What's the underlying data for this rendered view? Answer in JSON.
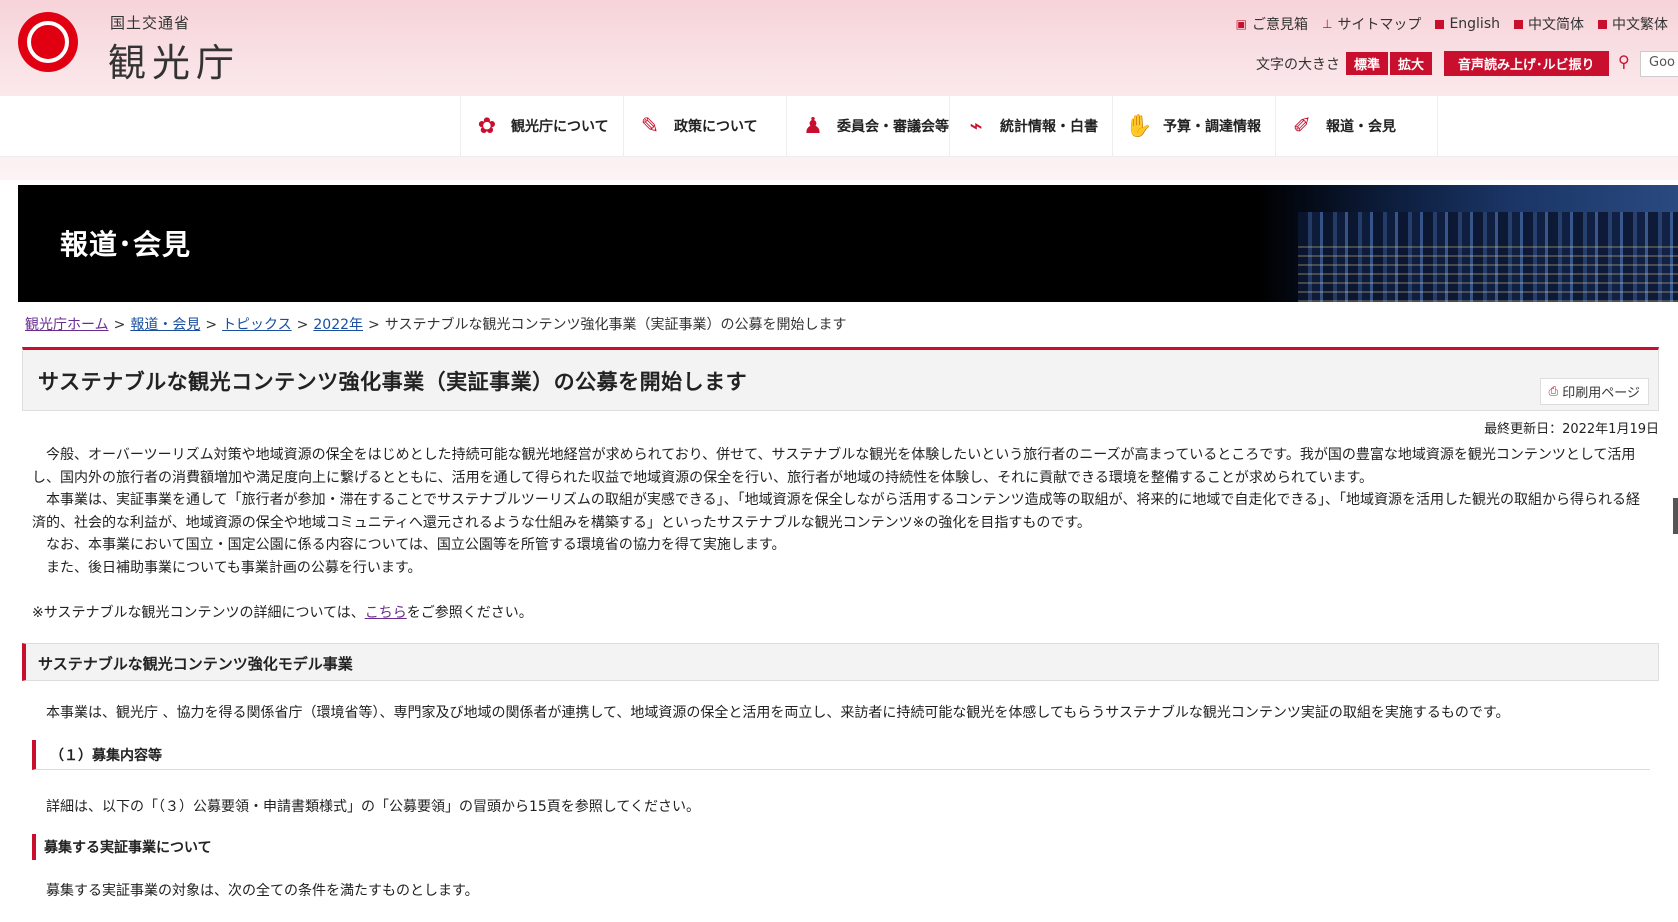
{
  "header": {
    "ministry": "国土交通省",
    "agency": "観光庁",
    "util_links": [
      {
        "label": "ご意見箱",
        "icon": "mailbox-icon"
      },
      {
        "label": "サイトマップ",
        "icon": "sitemap-icon"
      },
      {
        "label": "English",
        "icon": "square-bullet-icon"
      },
      {
        "label": "中文简体",
        "icon": "square-bullet-icon"
      },
      {
        "label": "中文繁体",
        "icon": "square-bullet-icon"
      }
    ],
    "font_size_label": "文字の大きさ",
    "font_standard": "標準",
    "font_large": "拡大",
    "voice_button": "音声読み上げ･ルビ振り",
    "search_placeholder": "Goo"
  },
  "nav": [
    {
      "label": "観光庁について",
      "icon": "flower-icon"
    },
    {
      "label": "政策について",
      "icon": "pencil-icon"
    },
    {
      "label": "委員会・審議会等",
      "icon": "people-icon"
    },
    {
      "label": "統計情報・白書",
      "icon": "chart-icon"
    },
    {
      "label": "予算・調達情報",
      "icon": "handshake-icon"
    },
    {
      "label": "報道・会見",
      "icon": "microphone-icon"
    }
  ],
  "banner": {
    "title": "報道･会見"
  },
  "breadcrumb": {
    "items": [
      "観光庁ホーム",
      "報道・会見",
      "トピックス",
      "2022年"
    ],
    "current": "サステナブルな観光コンテンツ強化事業（実証事業）の公募を開始します",
    "separator": ">"
  },
  "page": {
    "title": "サステナブルな観光コンテンツ強化事業（実証事業）の公募を開始します",
    "print_label": "印刷用ページ",
    "updated": "最終更新日：2022年1月19日",
    "paragraphs": [
      "今般、オーバーツーリズム対策や地域資源の保全をはじめとした持続可能な観光地経営が求められており、併せて、サステナブルな観光を体験したいという旅行者のニーズが高まっているところです。我が国の豊富な地域資源を観光コンテンツとして活用し、国内外の旅行者の消費額増加や満足度向上に繋げるとともに、活用を通して得られた収益で地域資源の保全を行い、旅行者が地域の持続性を体験し、それに貢献できる環境を整備することが求められています。",
      "本事業は、実証事業を通して「旅行者が参加・滞在することでサステナブルツーリズムの取組が実感できる」、「地域資源を保全しながら活用するコンテンツ造成等の取組が、将来的に地域で自走化できる」、「地域資源を活用した観光の取組から得られる経済的、社会的な利益が、地域資源の保全や地域コミュニティへ還元されるような仕組みを構築する」といったサステナブルな観光コンテンツ※の強化を目指すものです。",
      "なお、本事業において国立・国定公園に係る内容については、国立公園等を所管する環境省の協力を得て実施します。",
      "また、後日補助事業についても事業計画の公募を行います。"
    ],
    "note_prefix": "※サステナブルな観光コンテンツの詳細については、",
    "note_link": "こちら",
    "note_suffix": "をご参照ください。",
    "section_title": "サステナブルな観光コンテンツ強化モデル事業",
    "section_text": "本事業は、観光庁 、協力を得る関係省庁（環境省等）、専門家及び地域の関係者が連携して、地域資源の保全と活用を両立し、来訪者に持続可能な観光を体感してもらうサステナブルな観光コンテンツ実証の取組を実施するものです。",
    "sub_title": "（１）募集内容等",
    "sub_text": "詳細は、以下の「（３）公募要領・申請書類様式」の「公募要領」の冒頭から15頁を参照してください。",
    "sub2_title": "募集する実証事業について",
    "sub2_text": "募集する実証事業の対象は、次の全ての条件を満たすものとします。"
  },
  "colors": {
    "accent": "#c8102e",
    "link": "#1a4fa0",
    "visited": "#6a2c91"
  }
}
